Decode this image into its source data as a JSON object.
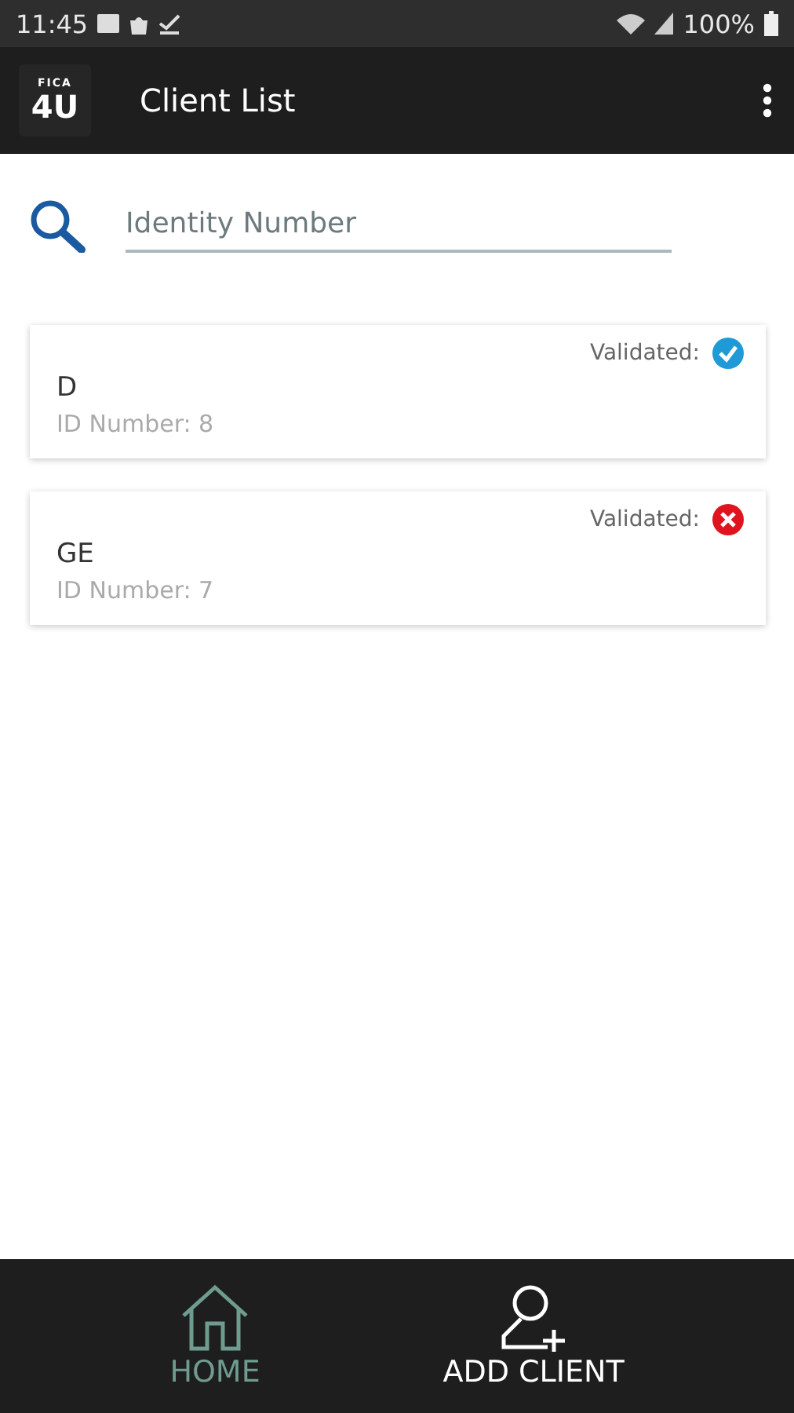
{
  "status_bar": {
    "time": "11:45",
    "battery": "100%"
  },
  "app_bar": {
    "logo_top": "FICA",
    "logo_main": "4U",
    "title": "Client List"
  },
  "search": {
    "placeholder": "Identity Number"
  },
  "clients": [
    {
      "name": "D",
      "id_line": "ID Number: 8",
      "validated_label": "Validated:",
      "validated": true
    },
    {
      "name": "GE",
      "id_line": "ID Number: 7",
      "validated_label": "Validated:",
      "validated": false
    }
  ],
  "nav": [
    {
      "label": "HOME",
      "kind": "home",
      "selected": true
    },
    {
      "label": "ADD CLIENT",
      "kind": "add-client",
      "selected": false
    }
  ]
}
